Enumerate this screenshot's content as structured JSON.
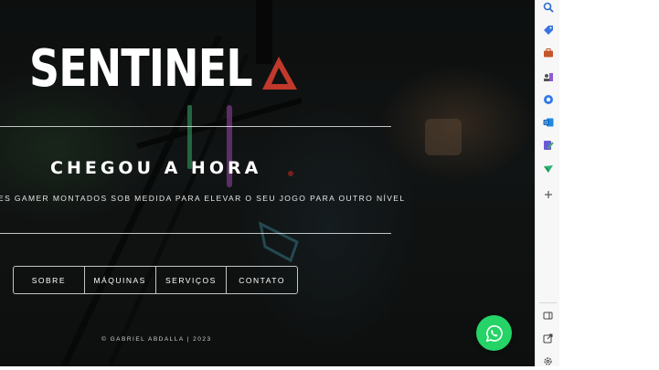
{
  "hero": {
    "logo": "SENTINEL",
    "headline": "CHEGOU A HORA",
    "subline": "ES GAMER MONTADOS SOB MEDIDA PARA ELEVAR O SEU JOGO PARA OUTRO NÍVEL",
    "footer": "© GABRIEL ABDALLA | 2023"
  },
  "nav": {
    "items": [
      {
        "label": "SOBRE"
      },
      {
        "label": "MÁQUINAS"
      },
      {
        "label": "SERVIÇOS"
      },
      {
        "label": "CONTATO"
      }
    ]
  },
  "whatsapp": {
    "icon": "whatsapp-icon"
  },
  "sidebar": {
    "icons": [
      "search-icon",
      "tag-icon",
      "briefcase-icon",
      "chess-icon",
      "m365-icon",
      "outlook-icon",
      "designer-icon",
      "send-icon",
      "plus-icon",
      "split-view-icon",
      "external-link-icon",
      "settings-icon"
    ]
  },
  "colors": {
    "accent": "#c0392b",
    "whatsapp": "#25d366",
    "hero_bg": "#1a1d1d"
  }
}
